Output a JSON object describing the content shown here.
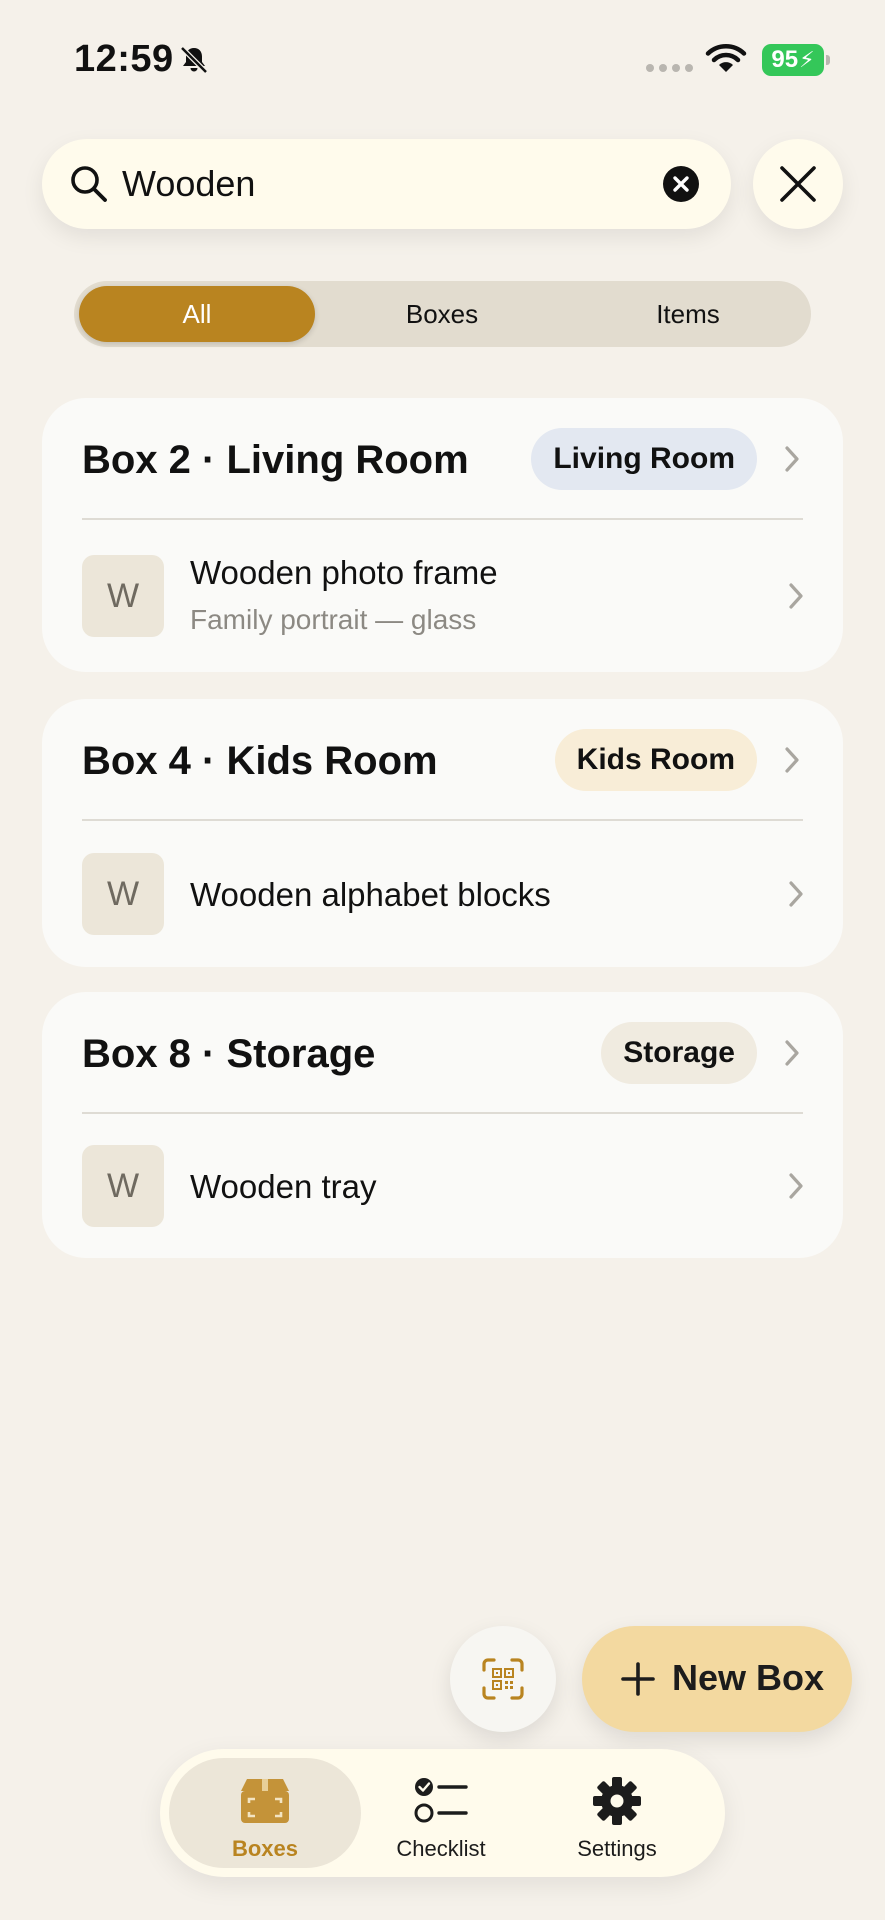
{
  "status_bar": {
    "time": "12:59",
    "battery": "95"
  },
  "search": {
    "value": "Wooden"
  },
  "filters": [
    {
      "label": "All",
      "active": true
    },
    {
      "label": "Boxes",
      "active": false
    },
    {
      "label": "Items",
      "active": false
    }
  ],
  "results": [
    {
      "title": "Box 2 · Living Room",
      "room": "Living Room",
      "room_color": "#e3e8f1",
      "items": [
        {
          "initial": "W",
          "name": "Wooden photo frame",
          "note": "Family portrait — glass"
        }
      ]
    },
    {
      "title": "Box 4 · Kids Room",
      "room": "Kids Room",
      "room_color": "#f8edd7",
      "items": [
        {
          "initial": "W",
          "name": "Wooden alphabet blocks",
          "note": ""
        }
      ]
    },
    {
      "title": "Box 8 · Storage",
      "room": "Storage",
      "room_color": "#f0ebe0",
      "items": [
        {
          "initial": "W",
          "name": "Wooden tray",
          "note": ""
        }
      ]
    }
  ],
  "actions": {
    "new_box_label": "New Box"
  },
  "tab_bar": [
    {
      "label": "Boxes",
      "icon": "box-icon",
      "active": true
    },
    {
      "label": "Checklist",
      "icon": "checklist-icon",
      "active": false
    },
    {
      "label": "Settings",
      "icon": "gear-icon",
      "active": false
    }
  ],
  "colors": {
    "accent": "#b98420",
    "background": "#f5f1ea",
    "new_box": "#f3d9a0"
  }
}
